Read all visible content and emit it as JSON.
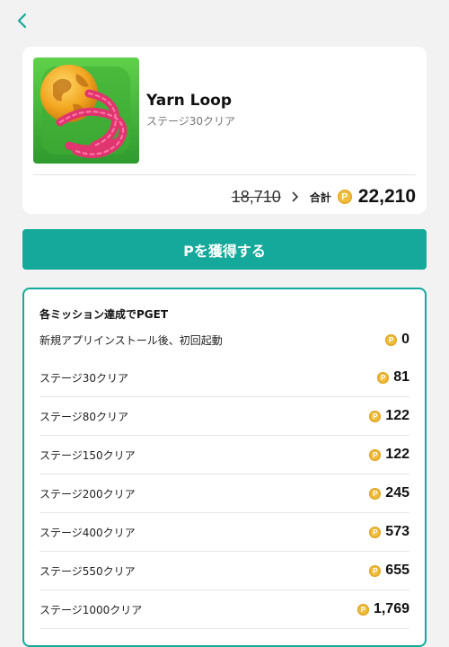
{
  "header": {
    "back_icon": "chevron-left-icon"
  },
  "app": {
    "name": "Yarn Loop",
    "subtitle": "ステージ30クリア",
    "old_points": "18,710",
    "total_label": "合計",
    "total_points": "22,210",
    "coin_symbol": "P"
  },
  "cta": {
    "label": "Pを獲得する",
    "color": "#14a99a"
  },
  "missions": {
    "title": "各ミッション達成でPGET",
    "items": [
      {
        "label": "新規アプリインストール後、初回起動",
        "points": "0"
      },
      {
        "label": "ステージ30クリア",
        "points": "81"
      },
      {
        "label": "ステージ80クリア",
        "points": "122"
      },
      {
        "label": "ステージ150クリア",
        "points": "122"
      },
      {
        "label": "ステージ200クリア",
        "points": "245"
      },
      {
        "label": "ステージ400クリア",
        "points": "573"
      },
      {
        "label": "ステージ550クリア",
        "points": "655"
      },
      {
        "label": "ステージ1000クリア",
        "points": "1,769"
      }
    ]
  }
}
